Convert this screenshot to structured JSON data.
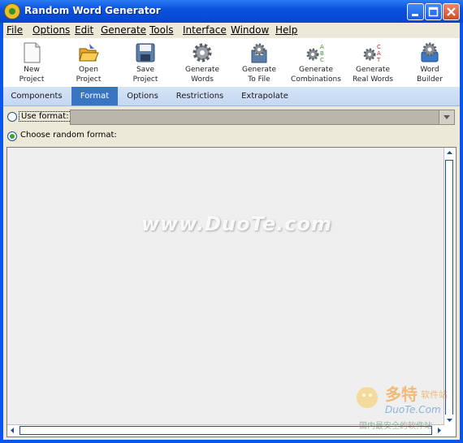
{
  "window": {
    "title": "Random Word Generator"
  },
  "menu": [
    "File",
    "Options",
    "Edit",
    "Generate",
    "Tools",
    "Interface",
    "Window",
    "Help"
  ],
  "toolbar": [
    {
      "label": "New\nProject",
      "icon": "new-project-icon"
    },
    {
      "label": "Open\nProject",
      "icon": "open-project-icon"
    },
    {
      "label": "Save\nProject",
      "icon": "save-project-icon"
    },
    {
      "label": "Generate\nWords",
      "icon": "gear-icon"
    },
    {
      "label": "Generate\nTo File",
      "icon": "gear-file-icon"
    },
    {
      "label": "Generate\nCombinations",
      "icon": "gear-abc-icon"
    },
    {
      "label": "Generate\nReal Words",
      "icon": "gear-cat-icon"
    },
    {
      "label": "Word\nBuilder",
      "icon": "word-builder-icon"
    }
  ],
  "tabs": [
    "Components",
    "Format",
    "Options",
    "Restrictions",
    "Extrapolate"
  ],
  "active_tab": "Format",
  "format": {
    "use_format_label": "Use format:",
    "use_format_selected": false,
    "use_format_value": "",
    "random_format_label": "Choose random format:",
    "random_format_selected": true
  },
  "watermark": {
    "text": "www.DuoTe.com"
  },
  "corner_watermark": {
    "brand_cn": "多特",
    "brand_sub": "软件站",
    "domain": "DuoTe.Com",
    "slogan": "国内最安全的软件站"
  },
  "colors": {
    "titlebar": "#0b52de",
    "active_tab": "#3a75c4",
    "radio_on": "#3aa53a"
  }
}
